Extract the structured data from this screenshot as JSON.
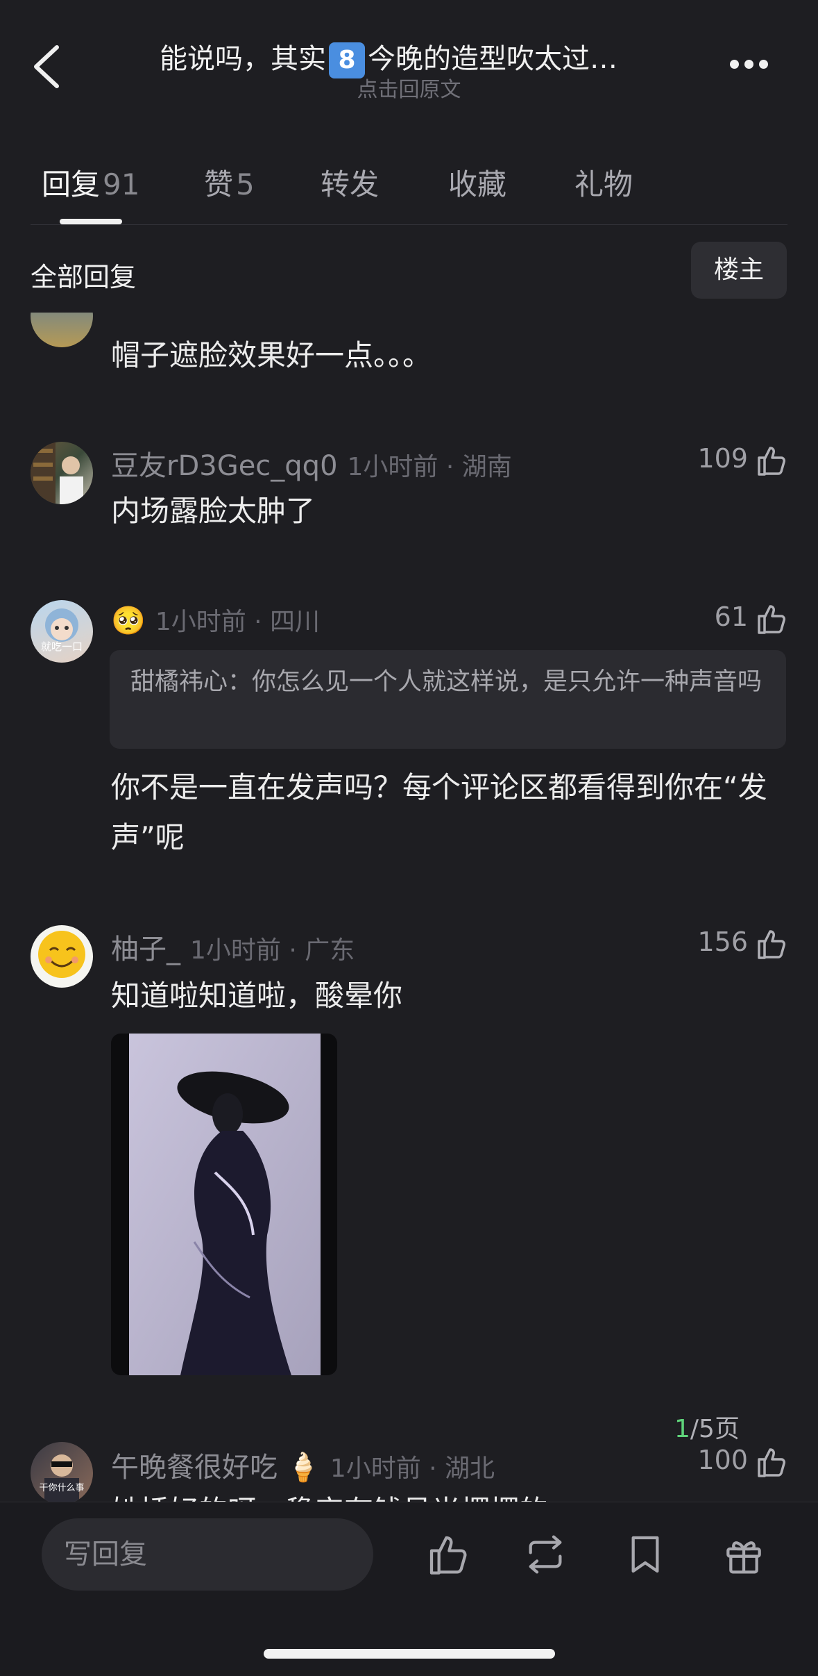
{
  "header": {
    "back_icon": "chevron-left-icon",
    "title_before": "能说吗，其实",
    "title_emoji": "8",
    "title_after": "今晚的造型吹太过…",
    "subtitle": "点击回原文",
    "more_icon": "ellipsis-icon"
  },
  "tabs": [
    {
      "label": "回复",
      "count": "91"
    },
    {
      "label": "赞",
      "count": "5"
    },
    {
      "label": "转发",
      "count": ""
    },
    {
      "label": "收藏",
      "count": ""
    },
    {
      "label": "礼物",
      "count": ""
    }
  ],
  "section": {
    "title": "全部回复",
    "filter_button": "楼主"
  },
  "comments": [
    {
      "text": "帽子遮脸效果好一点。。。"
    },
    {
      "user": "豆友rD3Gec_qq0",
      "meta": "1小时前 · 湖南",
      "likes": "109",
      "text": "内场露脸太肿了"
    },
    {
      "user": "🥺",
      "meta": "1小时前 · 四川",
      "likes": "61",
      "avatar_text": "就吃一口",
      "quote": "甜橘祎心：你怎么见一个人就这样说，是只允许一种声音吗",
      "text": "你不是一直在发声吗？每个评论区都看得到你在“发声”呢"
    },
    {
      "user": "柚子_",
      "meta": "1小时前 · 广东",
      "likes": "156",
      "text": "知道啦知道啦，酸晕你"
    },
    {
      "user": "午晚餐很好吃",
      "badge": "🍦",
      "meta": "1小时前 · 湖北",
      "likes": "100",
      "avatar_text": "干你什么事",
      "text": "她插好的呀，稳定有钱号光摆摆的"
    }
  ],
  "pager": {
    "current": "1",
    "rest": "/5页"
  },
  "bottom_bar": {
    "reply_placeholder": "写回复",
    "icons": [
      "thumbs-up-icon",
      "repost-icon",
      "bookmark-icon",
      "gift-icon"
    ]
  }
}
